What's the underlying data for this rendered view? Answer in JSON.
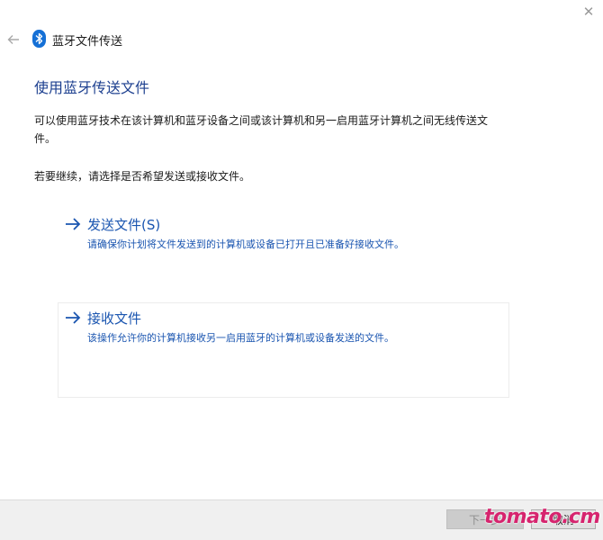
{
  "window": {
    "title": "蓝牙文件传送",
    "close_glyph": "✕"
  },
  "page": {
    "title": "使用蓝牙传送文件",
    "description": "可以使用蓝牙技术在该计算机和蓝牙设备之间或该计算机和另一启用蓝牙计算机之间无线传送文件。",
    "instruction": "若要继续，请选择是否希望发送或接收文件。"
  },
  "options": [
    {
      "title": "发送文件(S)",
      "description": "请确保你计划将文件发送到的计算机或设备已打开且已准备好接收文件。"
    },
    {
      "title": "接收文件",
      "description": "该操作允许你的计算机接收另一启用蓝牙的计算机或设备发送的文件。"
    }
  ],
  "footer": {
    "next_label": "下一步",
    "cancel_label": "取消"
  },
  "watermark": "tomato.cm",
  "colors": {
    "title_blue": "#1c3f8f",
    "link_blue": "#1a55b0",
    "bluetooth_blue": "#1570d6",
    "watermark_pink": "#d6246e"
  },
  "icons": {
    "back": "back-arrow-icon",
    "bluetooth": "bluetooth-icon",
    "option_arrow": "right-arrow-icon",
    "close": "close-icon"
  }
}
